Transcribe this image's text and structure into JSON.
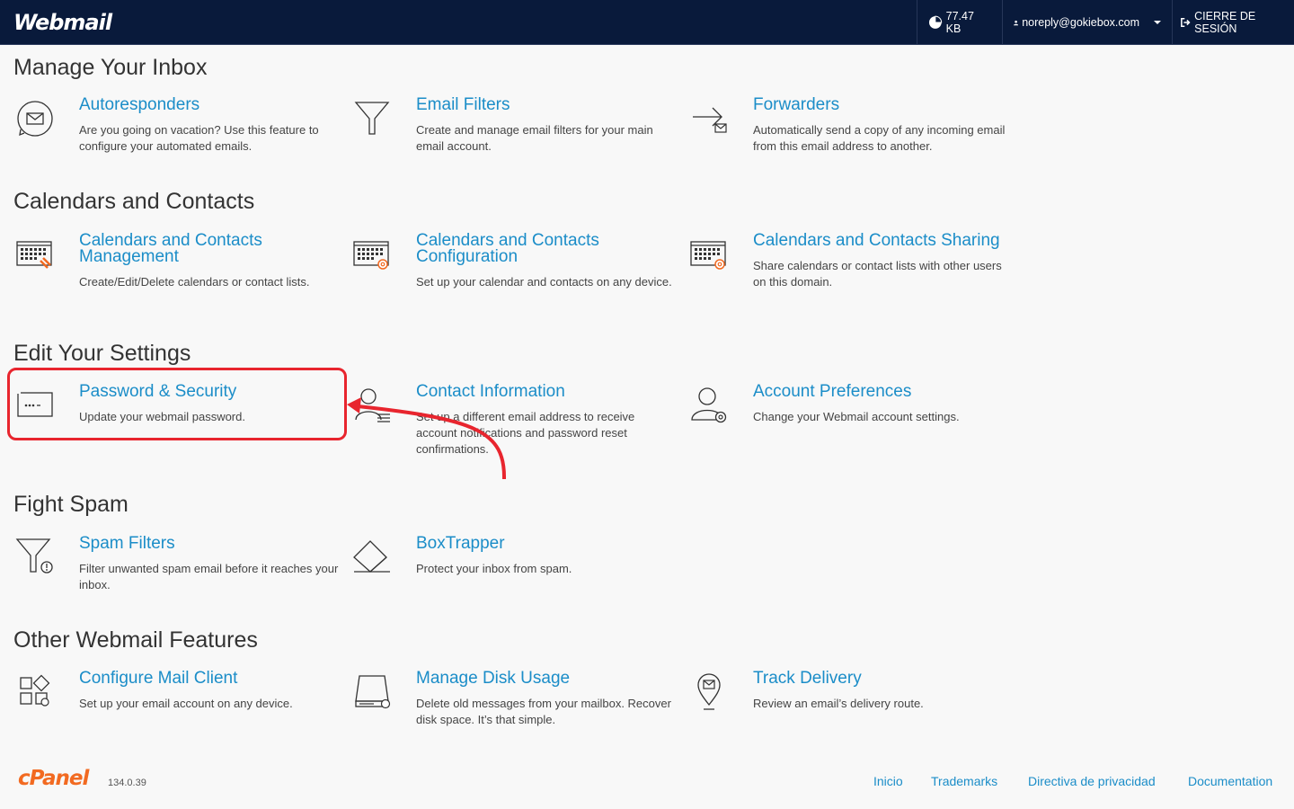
{
  "header": {
    "logo": "Webmail",
    "disk_usage": "77.47 KB",
    "user_email": "noreply@gokiebox.com",
    "logout_label": "CIERRE DE SESIÓN"
  },
  "sections": {
    "inbox": {
      "title": "Manage Your Inbox",
      "autoresponders": {
        "title": "Autoresponders",
        "desc": "Are you going on vacation? Use this feature to configure your automated emails."
      },
      "email_filters": {
        "title": "Email Filters",
        "desc": "Create and manage email filters for your main email account."
      },
      "forwarders": {
        "title": "Forwarders",
        "desc": "Automatically send a copy of any incoming email from this email address to another."
      }
    },
    "calendars": {
      "title": "Calendars and Contacts",
      "management": {
        "title": "Calendars and Contacts Management",
        "desc": "Create/Edit/Delete calendars or contact lists."
      },
      "configuration": {
        "title": "Calendars and Contacts Configuration",
        "desc": "Set up your calendar and contacts on any device."
      },
      "sharing": {
        "title": "Calendars and Contacts Sharing",
        "desc": "Share calendars or contact lists with other users on this domain."
      }
    },
    "settings": {
      "title": "Edit Your Settings",
      "password": {
        "title": "Password & Security",
        "desc": "Update your webmail password."
      },
      "contact": {
        "title": "Contact Information",
        "desc": "Set up a different email address to receive account notifications and password reset confirmations."
      },
      "preferences": {
        "title": "Account Preferences",
        "desc": "Change your Webmail account settings."
      }
    },
    "spam": {
      "title": "Fight Spam",
      "spam_filters": {
        "title": "Spam Filters",
        "desc": "Filter unwanted spam email before it reaches your inbox."
      },
      "boxtrapper": {
        "title": "BoxTrapper",
        "desc": "Protect your inbox from spam."
      }
    },
    "other": {
      "title": "Other Webmail Features",
      "mail_client": {
        "title": "Configure Mail Client",
        "desc": "Set up your email account on any device."
      },
      "disk_usage": {
        "title": "Manage Disk Usage",
        "desc": "Delete old messages from your mailbox. Recover disk space. It’s that simple."
      },
      "track_delivery": {
        "title": "Track Delivery",
        "desc": "Review an email’s delivery route."
      }
    }
  },
  "footer": {
    "logo": "cPanel",
    "version": "134.0.39",
    "links": [
      "Inicio",
      "Trademarks",
      "Directiva de privacidad",
      "Documentation"
    ]
  },
  "colors": {
    "header_bg": "#091a3b",
    "link": "#1b8dc8",
    "highlight": "#e8252e",
    "cpanel_orange": "#f26a21"
  }
}
